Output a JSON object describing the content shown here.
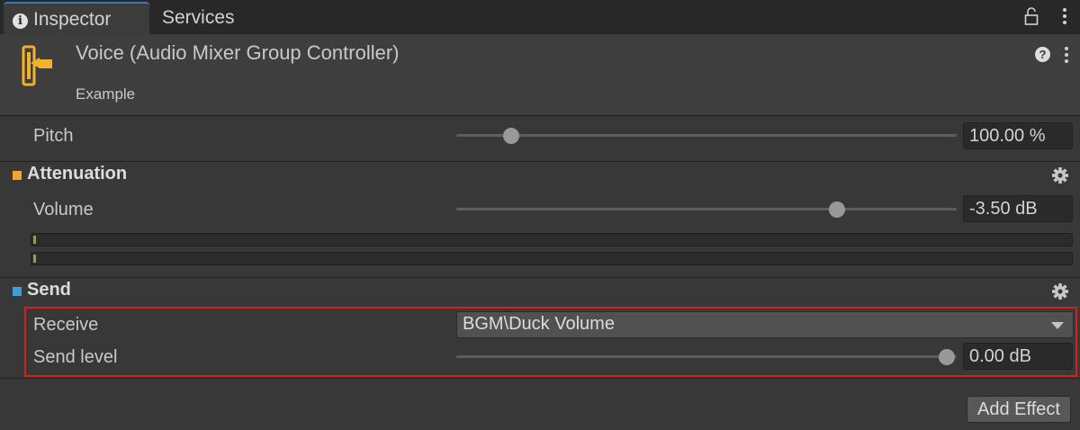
{
  "tabs": {
    "inspector": "Inspector",
    "services": "Services",
    "info_icon": "i"
  },
  "header": {
    "title": "Voice (Audio Mixer Group Controller)",
    "subtitle": "Example",
    "help_icon": "?"
  },
  "pitch": {
    "label": "Pitch",
    "value": "100.00 %",
    "slider_fraction": 0.11
  },
  "attenuation": {
    "title": "Attenuation",
    "swatch_color": "#f4a52c",
    "volume_label": "Volume",
    "volume_value": "-3.50 dB",
    "slider_fraction": 0.76
  },
  "send": {
    "title": "Send",
    "swatch_color": "#3d9fd6",
    "receive_label": "Receive",
    "receive_value": "BGM\\Duck Volume",
    "send_level_label": "Send level",
    "send_level_value": "0.00 dB",
    "slider_fraction": 0.98
  },
  "footer": {
    "add_effect_label": "Add Effect"
  },
  "colors": {
    "highlight": "#d0241b",
    "accent_tab": "#3a79bb",
    "component_icon": "#f4b12c"
  }
}
